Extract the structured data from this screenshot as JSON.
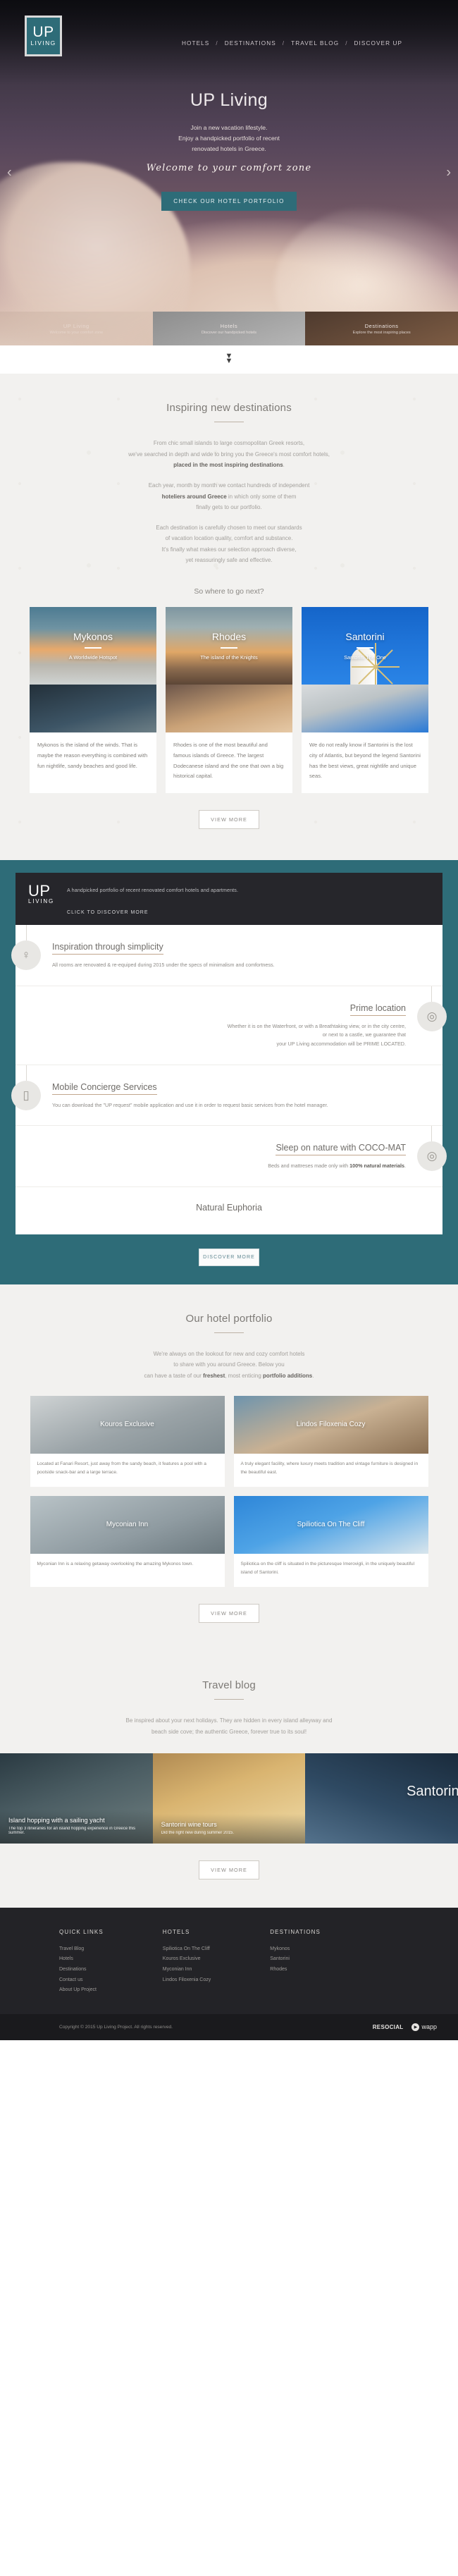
{
  "brand": {
    "up": "UP",
    "living": "LIVING"
  },
  "nav": {
    "items": [
      {
        "label": "HOTELS"
      },
      {
        "label": "DESTINATIONS"
      },
      {
        "label": "TRAVEL BLOG"
      },
      {
        "label": "DISCOVER UP"
      }
    ],
    "separator": "/"
  },
  "hero": {
    "title": "UP Living",
    "sub_line1": "Join a new vacation lifestyle.",
    "sub_line2": "Enjoy a handpicked portfolio of recent",
    "sub_line3": "renovated hotels in Greece.",
    "script": "Welcome to your comfort zone",
    "cta": "CHECK OUR HOTEL PORTFOLIO",
    "prev_arrow": "‹",
    "next_arrow": "›",
    "thumbs": [
      {
        "title": "UP Living",
        "desc": "Welcome to your comfort zone"
      },
      {
        "title": "Hotels",
        "desc": "Discover our handpicked hotels"
      },
      {
        "title": "Destinations",
        "desc": "Explore the most inspiring places"
      }
    ],
    "scroll_chevron": "»"
  },
  "destinations": {
    "title": "Inspiring new destinations",
    "p1_a": "From chic small islands to large cosmopolitan Greek resorts,",
    "p1_b": "we've searched in depth and wide to bring you the Greece's most comfort hotels,",
    "p1_bold": "placed in the most inspiring destinations",
    "p1_end": ".",
    "p2_a": "Each year, month by month we contact hundreds of independent",
    "p2_bold": "hoteliers around Greece",
    "p2_b": " in which only some of them",
    "p2_c": "finally gets to our portfolio.",
    "p3_a": "Each destination is carefully chosen to meet our standards",
    "p3_b": "of vacation location quality, comfort and substance.",
    "p3_c": "It's finally what makes our selection approach diverse,",
    "p3_d": "yet reassuringly safe and effective.",
    "subtitle": "So where to go next?",
    "view_more": "VIEW MORE",
    "cards": [
      {
        "name": "Mykonos",
        "tagline": "A Worldwide Hotspot",
        "text": "Mykonos is the island of the winds. That is maybe the reason everything is combined with fun nightlife, sandy beaches and good life."
      },
      {
        "name": "Rhodes",
        "tagline": "The island of the Knights",
        "text": "Rhodes is one of the most beautiful and famous islands of Greece. The largest Dodecanese island and the one that own a big historical capital."
      },
      {
        "name": "Santorini",
        "tagline": "Santorini The One",
        "text": "We do not really know if Santorini is the lost city of Atlantis, but beyond the legend Santorini has the best views, great nightlife and unique seas."
      }
    ]
  },
  "discover": {
    "tagline": "A handpicked portfolio of recent renovated comfort hotels and apartments.",
    "click_more": "CLICK TO DISCOVER MORE",
    "features": [
      {
        "heading": "Inspiration through simplicity",
        "text": "All rooms are renovated & re-equiped during 2015 under the specs of minimalism and comfortness.",
        "icon": "lamp-icon",
        "glyph": "♀",
        "align": "left"
      },
      {
        "heading": "Prime location",
        "text_a": "Whether it is on the Waterfront, or with a Breathtaking view, or in the city centre,",
        "text_b": "or next to a castle, we guarantee that",
        "text_c": "your UP Living accommodation will be PRIME LOCATED.",
        "icon": "map-pin-icon",
        "glyph": "◎",
        "align": "right"
      },
      {
        "heading": "Mobile Concierge Services",
        "text": "You can download  the \"UP request\" mobile application and use it in order to request basic services from the hotel manager.",
        "icon": "mobile-phone-icon",
        "glyph": "▯",
        "align": "left"
      },
      {
        "heading": "Sleep on nature with COCO-MAT",
        "text_a": "Beds and mattreses made only with ",
        "text_bold": "100% natural materials",
        "text_b": ".",
        "icon": "spiral-icon",
        "glyph": "◎",
        "align": "right"
      }
    ],
    "euphoria": "Natural Euphoria",
    "cta": "DISCOVER MORE"
  },
  "portfolio": {
    "title": "Our hotel portfolio",
    "p_a": "We're always on the lookout for new and cozy comfort hotels",
    "p_b": "to share with you around Greece. Below you",
    "p_c_a": "can have a taste of our ",
    "p_c_bold": "freshest",
    "p_c_b": ", most enticing ",
    "p_c_bold2": "portfolio additions",
    "p_c_end": ".",
    "view_more": "VIEW MORE",
    "hotels": [
      {
        "name": "Kouros Exclusive",
        "text": "Located at Fanari Resort, just away from the sandy beach, it features a pool with a poolside snack-bar and a large terrace."
      },
      {
        "name": "Lindos Filoxenia Cozy",
        "text": "A truly elegant facility, where luxury meets tradition and vintage furniture is designed in the beautiful east."
      },
      {
        "name": "Myconian Inn",
        "text": "Myconian Inn is a relaxing getaway overlooking the amazing Mykonos town."
      },
      {
        "name": "Spiliotica On The Cliff",
        "text": "Spiliotica on the cliff is situated in the picturesque Imerovigli, in the uniquely beautiful island of Santorini."
      }
    ]
  },
  "blog": {
    "title": "Travel blog",
    "p_a": "Be inspired about your next holidays. They are hidden in every island alleyway and",
    "p_b": "beach side cove; the authentic Greece, forever true to its soul!",
    "view_more": "VIEW MORE",
    "posts": [
      {
        "title": "Island hopping with a sailing yacht",
        "desc": "The top 3 itineraries for an island hopping experience in Greece this summer."
      },
      {
        "title": "Santorini wine tours",
        "desc": "Did the right new during summer 2015."
      },
      {
        "title": "Santorini",
        "desc": ""
      }
    ]
  },
  "footer": {
    "columns": [
      {
        "heading": "QUICK LINKS",
        "links": [
          "Travel Blog",
          "Hotels",
          "Destinations",
          "Contact us",
          "About Up Project"
        ]
      },
      {
        "heading": "HOTELS",
        "links": [
          "Spiliotica On The Cliff",
          "Kouros Exclusive",
          "Myconian Inn",
          "Lindos Filoxenia Cozy"
        ]
      },
      {
        "heading": "DESTINATIONS",
        "links": [
          "Mykonos",
          "Santorini",
          "Rhodes"
        ]
      }
    ],
    "copyright": "Copyright © 2015 Up Living Project. All rights reserved.",
    "brand_resocial": "RESOCIAL",
    "brand_wapp": "wapp",
    "wapp_glyph": "▶"
  }
}
